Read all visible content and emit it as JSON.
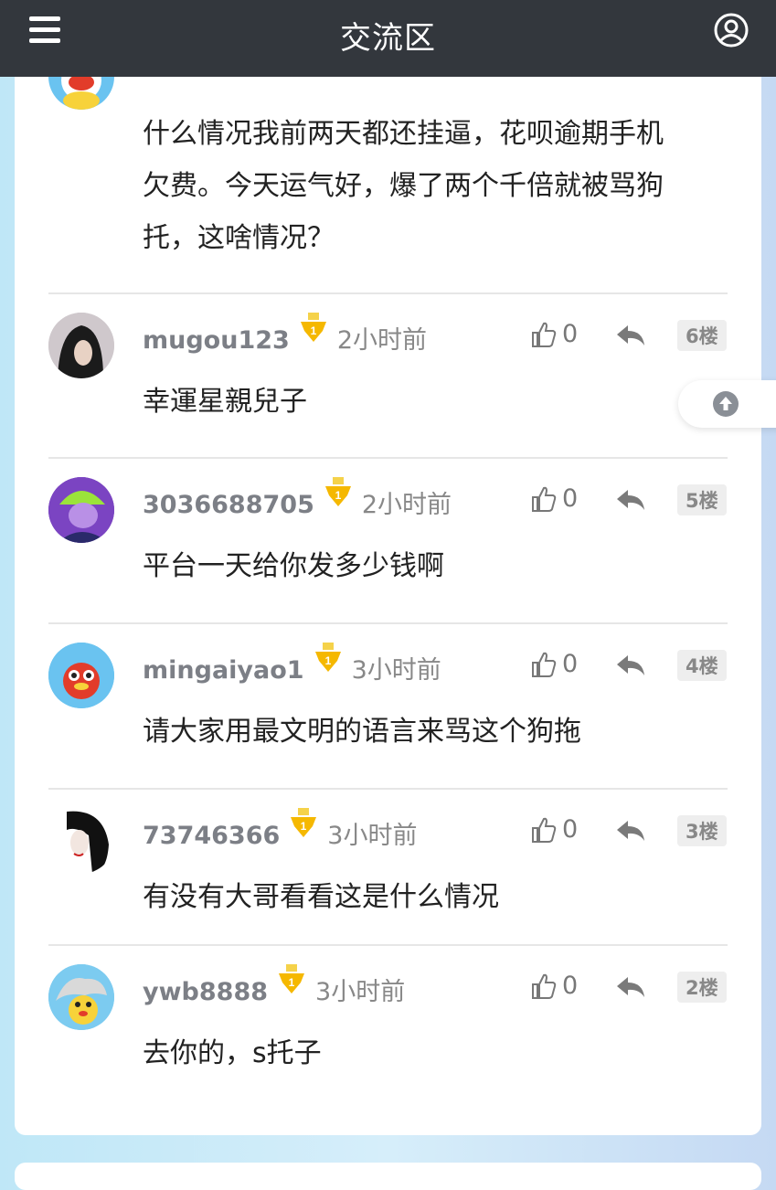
{
  "header": {
    "title": "交流区",
    "menu_icon": "menu-icon",
    "user_icon": "user-circle-icon"
  },
  "top_comment": {
    "text_lines": [
      "什么情况我前两天都还挂逼，花呗逾期手机",
      "欠费。今天运气好，爆了两个千倍就被骂狗",
      "托，这啥情况？"
    ]
  },
  "comments": [
    {
      "username": "mugou123",
      "time": "2小时前",
      "likes": "0",
      "floor": "6楼",
      "text": "幸運星親兒子"
    },
    {
      "username": "3036688705",
      "time": "2小时前",
      "likes": "0",
      "floor": "5楼",
      "text": "平台一天给你发多少钱啊"
    },
    {
      "username": "mingaiyao1",
      "time": "3小时前",
      "likes": "0",
      "floor": "4楼",
      "text": "请大家用最文明的语言来骂这个狗拖"
    },
    {
      "username": "73746366",
      "time": "3小时前",
      "likes": "0",
      "floor": "3楼",
      "text": "有没有大哥看看这是什么情况"
    },
    {
      "username": "ywb8888",
      "time": "3小时前",
      "likes": "0",
      "floor": "2楼",
      "text": "去你的，s托子"
    }
  ],
  "colors": {
    "header_bg": "#33373d",
    "badge_gold": "#f5b800",
    "floor_bg": "#eeeeee"
  }
}
